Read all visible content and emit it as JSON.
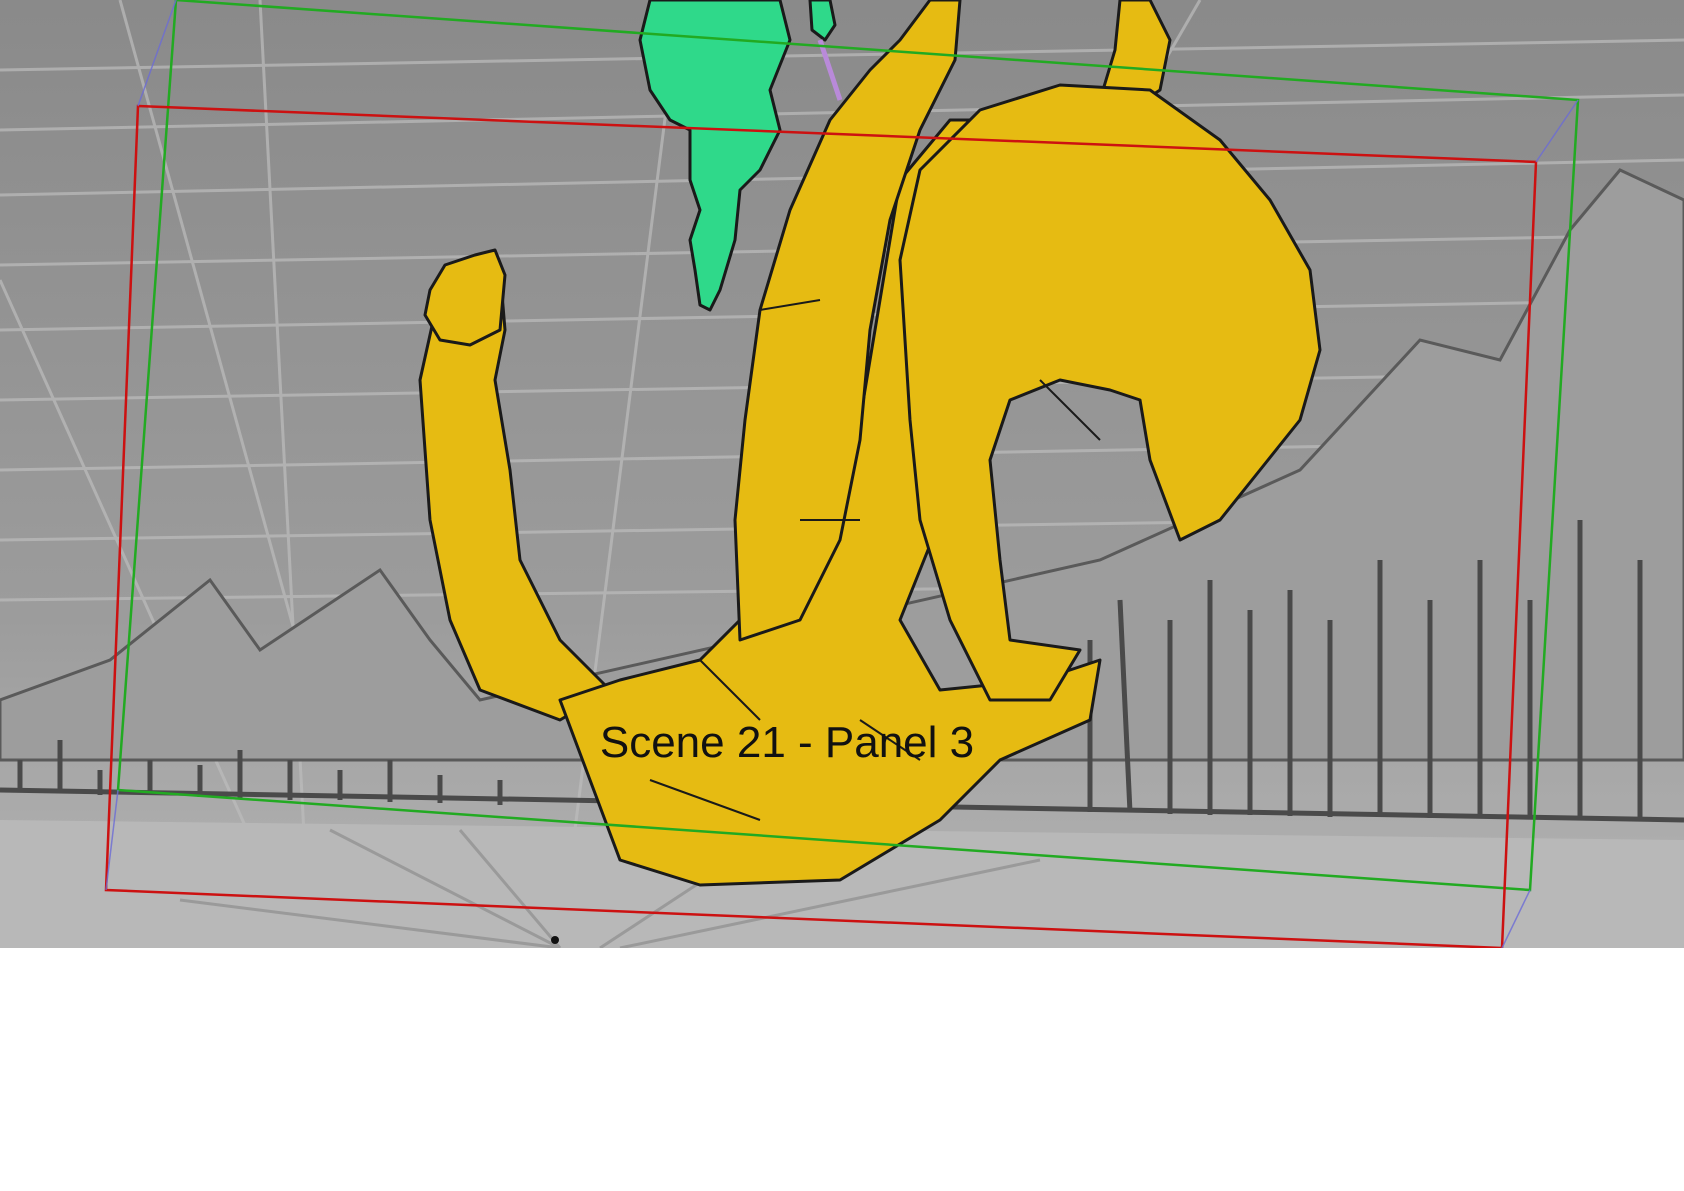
{
  "panel": {
    "caption": "Scene 21 - Panel 3"
  },
  "colors": {
    "sky_top": "#8c8c8c",
    "sky_bottom": "#a8a8a8",
    "ground": "#b9b9b9",
    "character_fill": "#e6bb12",
    "small_character_fill": "#2fd98a",
    "action_safe_frame": "#22aa22",
    "camera_frame": "#cc1111",
    "ink": "#1a1a1a",
    "page_background": "#ffffff"
  },
  "icons": {
    "frame_corner": "none"
  }
}
